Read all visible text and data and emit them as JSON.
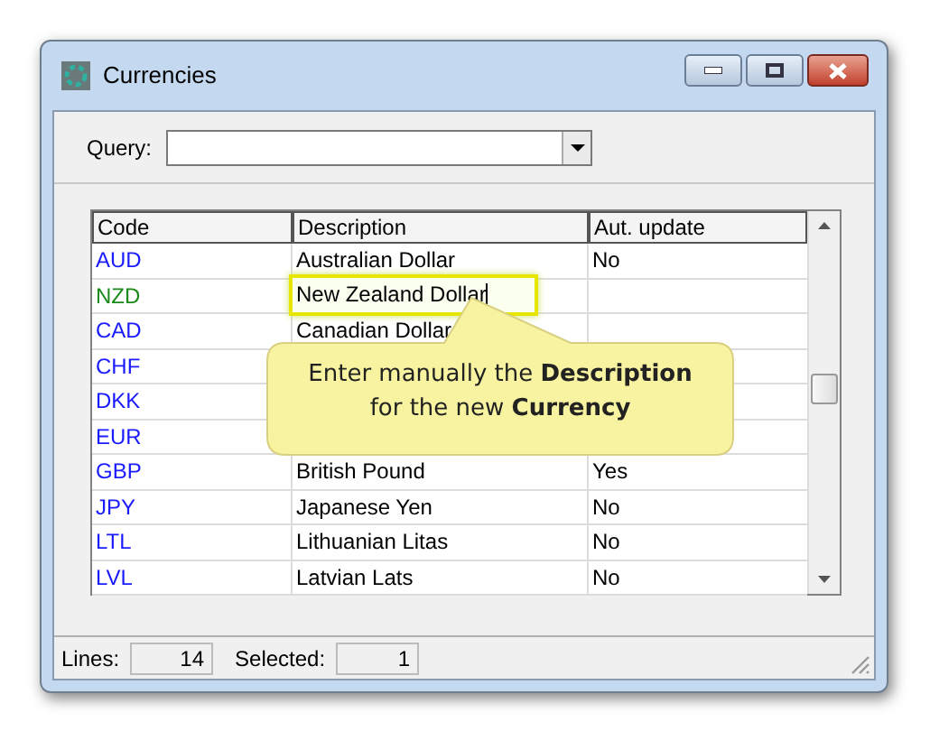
{
  "window": {
    "title": "Currencies"
  },
  "query": {
    "label": "Query:"
  },
  "table": {
    "columns": [
      "Code",
      "Description",
      "Aut. update"
    ],
    "rows": [
      {
        "code": "AUD",
        "color": "#1a1aff",
        "description": "Australian Dollar",
        "aut_update": "No",
        "editing": false
      },
      {
        "code": "NZD",
        "color": "#1a8a1a",
        "description": "New Zealand Dollar",
        "editing": true
      },
      {
        "code": "CAD",
        "color": "#1a1aff",
        "description": "Canadian Dollar",
        "editing": false
      },
      {
        "code": "CHF",
        "color": "#1a1aff",
        "editing": false
      },
      {
        "code": "DKK",
        "color": "#1a1aff",
        "editing": false
      },
      {
        "code": "EUR",
        "color": "#1a1aff",
        "editing": false
      },
      {
        "code": "GBP",
        "color": "#1a1aff",
        "description": "British Pound",
        "aut_update": "Yes",
        "editing": false
      },
      {
        "code": "JPY",
        "color": "#1a1aff",
        "description": "Japanese Yen",
        "aut_update": "No",
        "editing": false
      },
      {
        "code": "LTL",
        "color": "#1a1aff",
        "description": "Lithuanian Litas",
        "aut_update": "No",
        "editing": false
      },
      {
        "code": "LVL",
        "color": "#1a1aff",
        "description": "Latvian Lats",
        "aut_update": "No",
        "editing": false
      }
    ]
  },
  "callout": {
    "text": "Enter manually the **Description** for the new **Currency**"
  },
  "status_bar": {
    "lines_label": "Lines:",
    "lines": "14",
    "selected_label": "Selected:",
    "selected": "1"
  }
}
